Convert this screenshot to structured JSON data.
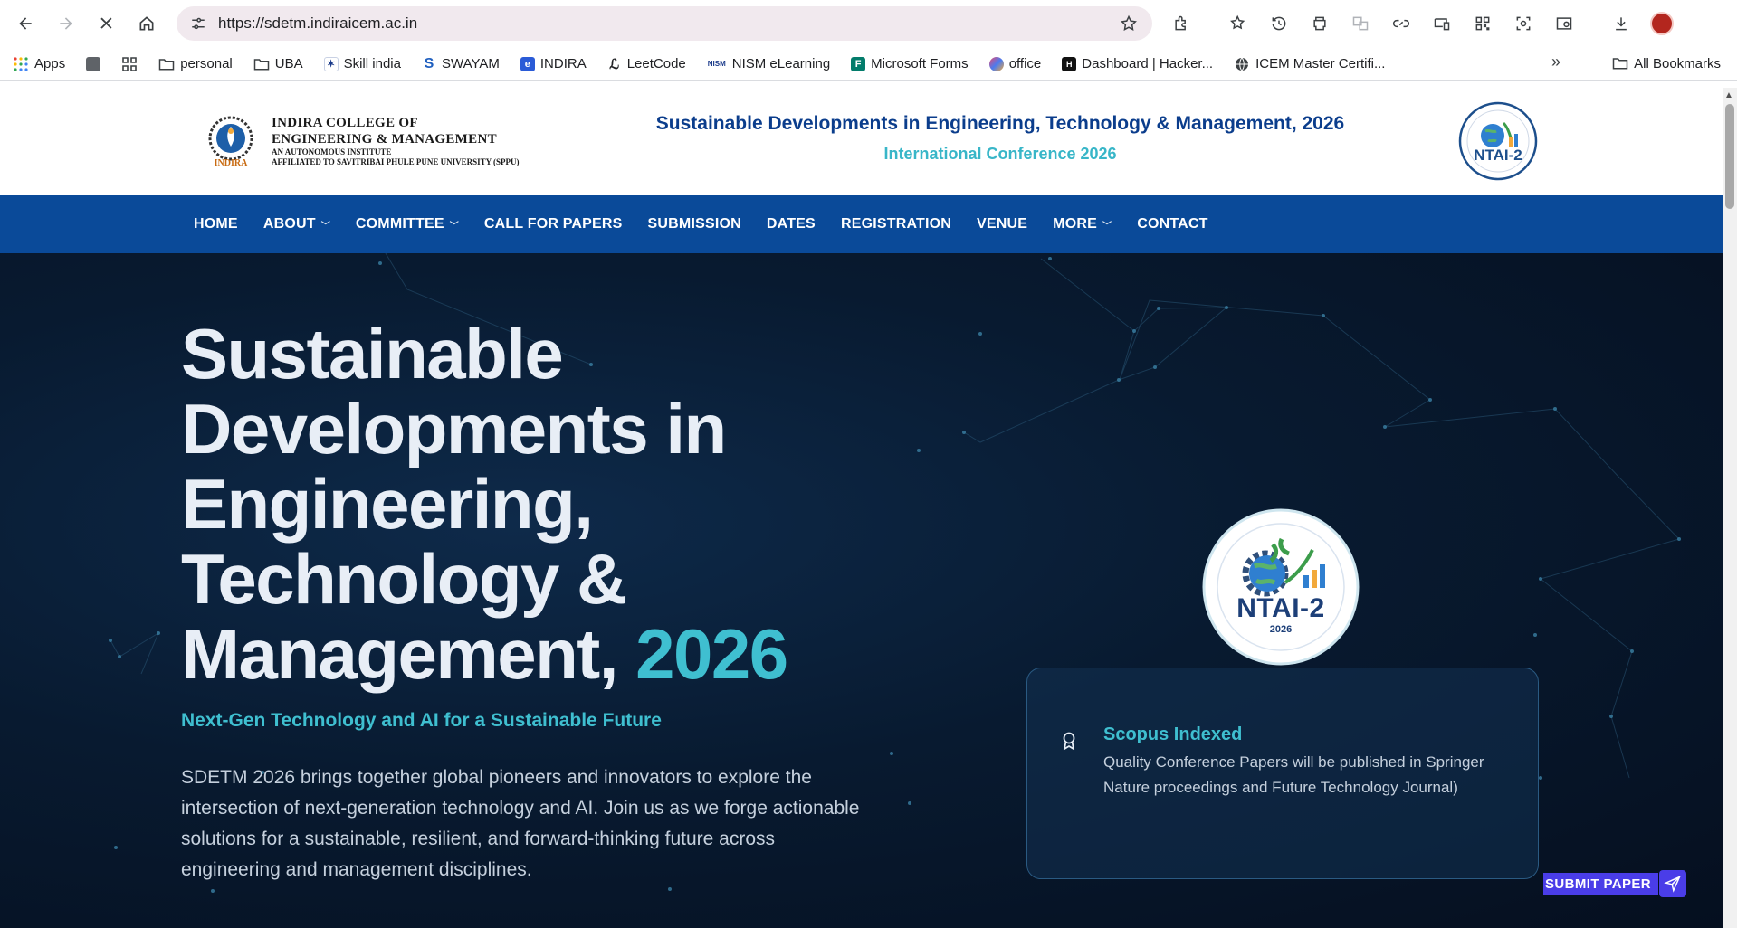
{
  "browser": {
    "url": "https://sdetm.indiraicem.ac.in",
    "bookmarks": [
      {
        "label": "Apps",
        "icon": "apps-grid-icon"
      },
      {
        "label": "",
        "icon": "gray-square-icon"
      },
      {
        "label": "",
        "icon": "grid-icon"
      },
      {
        "label": "personal",
        "icon": "folder-icon"
      },
      {
        "label": "UBA",
        "icon": "folder-icon"
      },
      {
        "label": "Skill india",
        "icon": "skill-india-icon"
      },
      {
        "label": "SWAYAM",
        "icon": "swayam-icon"
      },
      {
        "label": "INDIRA",
        "icon": "indira-icon"
      },
      {
        "label": "LeetCode",
        "icon": "leetcode-icon"
      },
      {
        "label": "NISM eLearning",
        "icon": "nism-icon"
      },
      {
        "label": "Microsoft Forms",
        "icon": "forms-icon"
      },
      {
        "label": "office",
        "icon": "office-icon"
      },
      {
        "label": "Dashboard | Hacker...",
        "icon": "hackerrank-icon"
      },
      {
        "label": "ICEM Master Certifi...",
        "icon": "globe-icon"
      }
    ],
    "all_bookmarks": "All Bookmarks",
    "more_glyph": "»"
  },
  "header": {
    "college_line1": "INDIRA COLLEGE OF",
    "college_line2": "ENGINEERING & MANAGEMENT",
    "college_line3": "AN AUTONOMOUS INSTITUTE",
    "college_line4": "AFFILIATED TO SAVITRIBAI PHULE PUNE UNIVERSITY (SPPU)",
    "logo_caption": "INDIRA",
    "title": "Sustainable Developments in Engineering, Technology & Management, 2026",
    "subtitle": "International Conference 2026",
    "emblem_text": "NTAI-2"
  },
  "nav": [
    {
      "label": "HOME",
      "dropdown": false
    },
    {
      "label": "ABOUT",
      "dropdown": true
    },
    {
      "label": "COMMITTEE",
      "dropdown": true
    },
    {
      "label": "CALL FOR PAPERS",
      "dropdown": false
    },
    {
      "label": "SUBMISSION",
      "dropdown": false
    },
    {
      "label": "DATES",
      "dropdown": false
    },
    {
      "label": "REGISTRATION",
      "dropdown": false
    },
    {
      "label": "VENUE",
      "dropdown": false
    },
    {
      "label": "MORE",
      "dropdown": true
    },
    {
      "label": "CONTACT",
      "dropdown": false
    }
  ],
  "hero": {
    "title_main": "Sustainable Developments in Engineering, Technology & Management,",
    "title_year": "2026",
    "tagline": "Next-Gen Technology and AI for a Sustainable Future",
    "description": "SDETM 2026 brings together global pioneers and innovators to explore the intersection of next-generation technology and AI. Join us as we forge actionable solutions for a sustainable, resilient, and forward-thinking future across engineering and management disciplines.",
    "emblem_text": "NTAI-2",
    "emblem_year": "2026",
    "card": {
      "title": "Scopus Indexed",
      "body": "Quality Conference Papers will be published in Springer Nature proceedings and Future Technology Journal)",
      "icon": "award-icon"
    },
    "submit_label": "SUBMIT PAPER"
  },
  "colors": {
    "nav_bg": "#0a4a99",
    "accent": "#3fbfd0",
    "header_title": "#0b3d8c",
    "submit_bg": "#4a3de8"
  }
}
